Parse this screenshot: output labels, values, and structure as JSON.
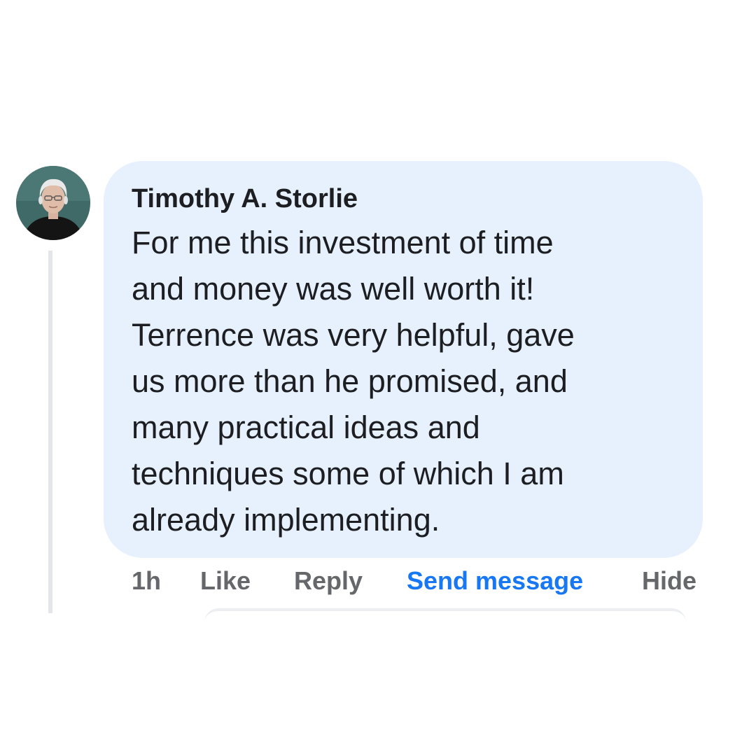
{
  "comment": {
    "author": "Timothy A. Storlie",
    "text_lines": [
      "For me this investment of time",
      "and money was well worth it!",
      "Terrence was very helpful, gave",
      "us more than he promised, and",
      "many practical ideas and",
      "techniques some of which I am",
      "already implementing."
    ],
    "avatar": "user-avatar-photo"
  },
  "actions": {
    "time": "1h",
    "like": "Like",
    "reply": "Reply",
    "send_message": "Send message",
    "hide": "Hide"
  },
  "colors": {
    "bubble": "#e6f1fd",
    "text": "#1c1e21",
    "muted": "#65676b",
    "accent": "#1877f2",
    "thread_line": "#e4e6ea"
  }
}
